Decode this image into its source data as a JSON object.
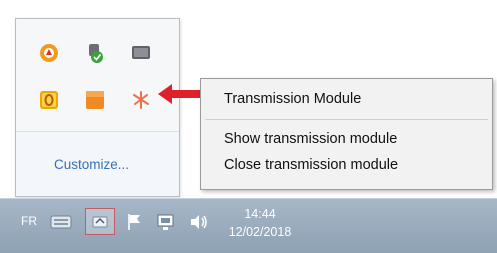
{
  "tray_overflow": {
    "icons": [
      {
        "name": "orange-update-icon",
        "interactable": true
      },
      {
        "name": "green-shield-icon",
        "interactable": true
      },
      {
        "name": "vm-icon",
        "interactable": true
      },
      {
        "name": "yellow-o-icon",
        "interactable": true
      },
      {
        "name": "orange-square-icon",
        "interactable": true
      },
      {
        "name": "transmission-module-icon",
        "interactable": true
      }
    ],
    "customize_label": "Customize..."
  },
  "context_menu": {
    "title_item": "Transmission Module",
    "show_item": "Show transmission module",
    "close_item": "Close transmission module"
  },
  "taskbar": {
    "language": "FR",
    "clock_time": "14:44",
    "clock_date": "12/02/2018"
  },
  "colors": {
    "arrow": "#e0202a",
    "link": "#3670b7",
    "taskbar": "#9aacbf"
  }
}
